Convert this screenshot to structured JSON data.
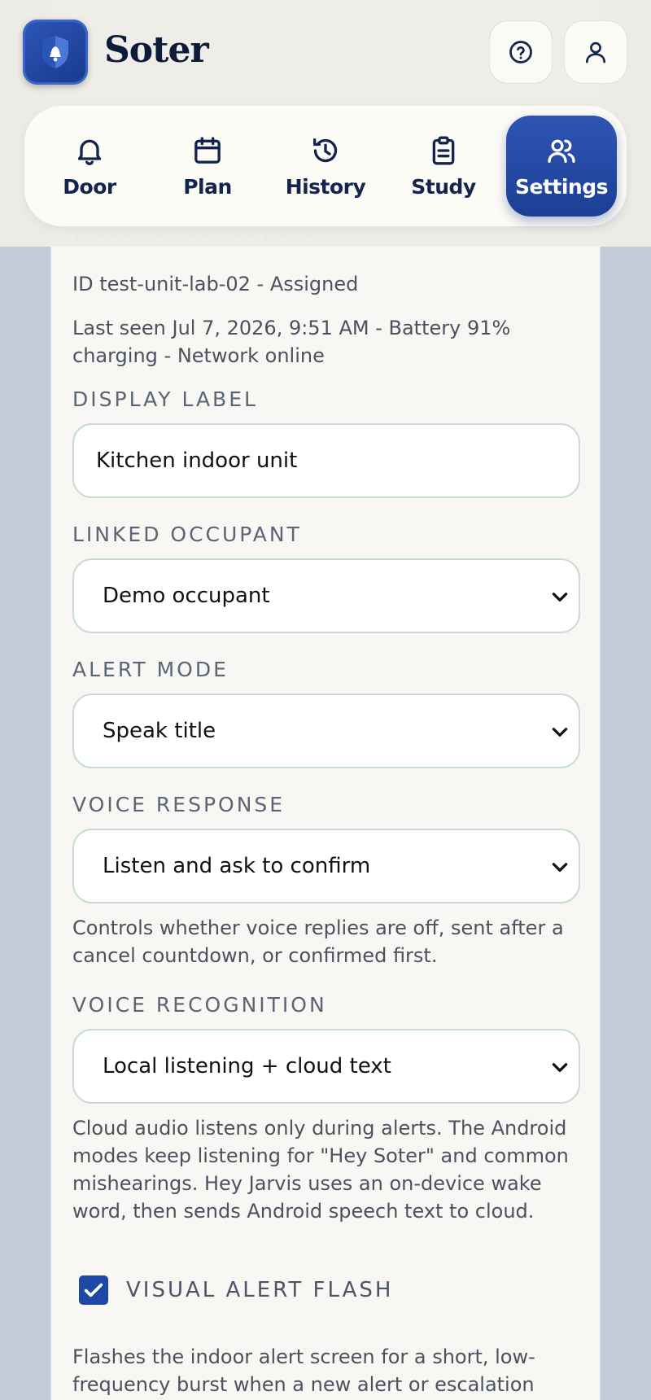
{
  "app": {
    "name": "Soter"
  },
  "header": {
    "help_icon": "help-circle-icon",
    "account_icon": "user-icon"
  },
  "nav": {
    "tabs": [
      {
        "label": "Door",
        "icon": "bell-icon",
        "active": false
      },
      {
        "label": "Plan",
        "icon": "calendar-icon",
        "active": false
      },
      {
        "label": "History",
        "icon": "history-icon",
        "active": false
      },
      {
        "label": "Study",
        "icon": "clipboard-icon",
        "active": false
      },
      {
        "label": "Settings",
        "icon": "users-icon",
        "active": true
      }
    ]
  },
  "unit": {
    "title": "Kitchen indoor unit",
    "id_line": "ID test-unit-lab-02 - Assigned",
    "status_line": "Last seen Jul 7, 2026, 9:51 AM - Battery 91% charging - Network online"
  },
  "form": {
    "display_label": {
      "label": "DISPLAY LABEL",
      "value": "Kitchen indoor unit"
    },
    "linked_occupant": {
      "label": "LINKED OCCUPANT",
      "value": "Demo occupant"
    },
    "alert_mode": {
      "label": "ALERT MODE",
      "value": "Speak title"
    },
    "voice_response": {
      "label": "VOICE RESPONSE",
      "value": "Listen and ask to confirm",
      "help": "Controls whether voice replies are off, sent after a cancel countdown, or confirmed first."
    },
    "voice_recognition": {
      "label": "VOICE RECOGNITION",
      "value": "Local listening + cloud text",
      "help": "Cloud audio listens only during alerts. The Android modes keep listening for \"Hey Soter\" and common mishearings. Hey Jarvis uses an on-device wake word, then sends Android speech text to cloud."
    },
    "visual_alert_flash": {
      "label": "VISUAL ALERT FLASH",
      "checked": true,
      "help": "Flashes the indoor alert screen for a short, low-frequency burst when a new alert or escalation"
    }
  },
  "colors": {
    "accent": "#1e48a5",
    "navy_text": "#13244e",
    "field_border": "#c7dcd6"
  }
}
